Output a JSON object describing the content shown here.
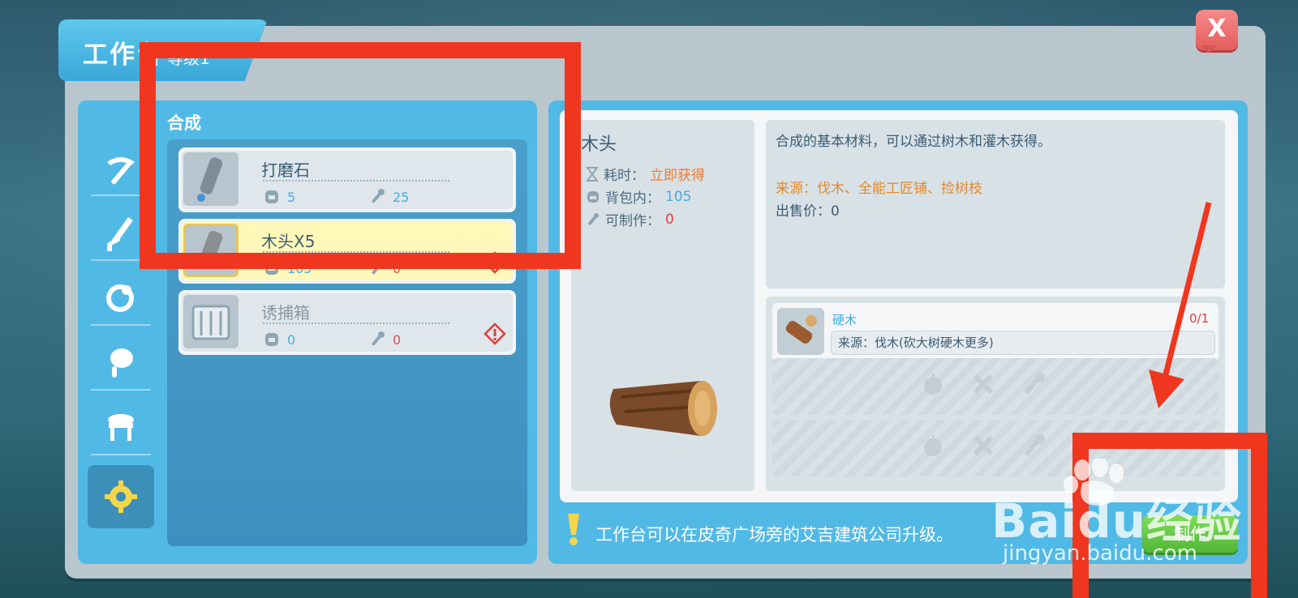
{
  "window": {
    "title": "工作台",
    "level": "等级1",
    "close_label": "X"
  },
  "categories": [
    {
      "icon": "pickaxe-icon",
      "active": false
    },
    {
      "icon": "sword-icon",
      "active": false
    },
    {
      "icon": "ring-icon",
      "active": false
    },
    {
      "icon": "food-icon",
      "active": false
    },
    {
      "icon": "furniture-icon",
      "active": false
    },
    {
      "icon": "gear-icon",
      "active": true
    }
  ],
  "list": {
    "title": "合成",
    "recipes": [
      {
        "name": "打磨石",
        "bag": "5",
        "craftable": "25",
        "warning": false
      },
      {
        "name": "木头X5",
        "bag": "105",
        "craftable": "0",
        "warning": true
      },
      {
        "name": "诱捕箱",
        "bag": "0",
        "craftable": "0",
        "warning": true
      }
    ]
  },
  "detail": {
    "name": "木头",
    "time_label": "耗时：",
    "time_value": "立即获得",
    "bag_label": "背包内：",
    "bag_value": "105",
    "craft_label": "可制作：",
    "craft_value": "0",
    "description": "合成的基本材料，可以通过树木和灌木获得。",
    "source": "来源：伐木、全能工匠铺、捡树枝",
    "price": "出售价：0"
  },
  "materials": [
    {
      "name": "硬木",
      "count": "0/1",
      "source": "来源：伐木(砍大树硬木更多)"
    }
  ],
  "tip": "工作台可以在皮奇广场旁的艾吉建筑公司升级。",
  "make_button": "制作",
  "watermark": {
    "brand": "Baidu经验",
    "url": "jingyan.baidu.com"
  },
  "colors": {
    "accent_blue": "#51b9e6",
    "selected_yellow": "#fff8b8",
    "warning_red": "#e33c3c",
    "source_orange": "#e38a2c",
    "make_green": "#52b737",
    "annotation_red": "#f0361e"
  }
}
